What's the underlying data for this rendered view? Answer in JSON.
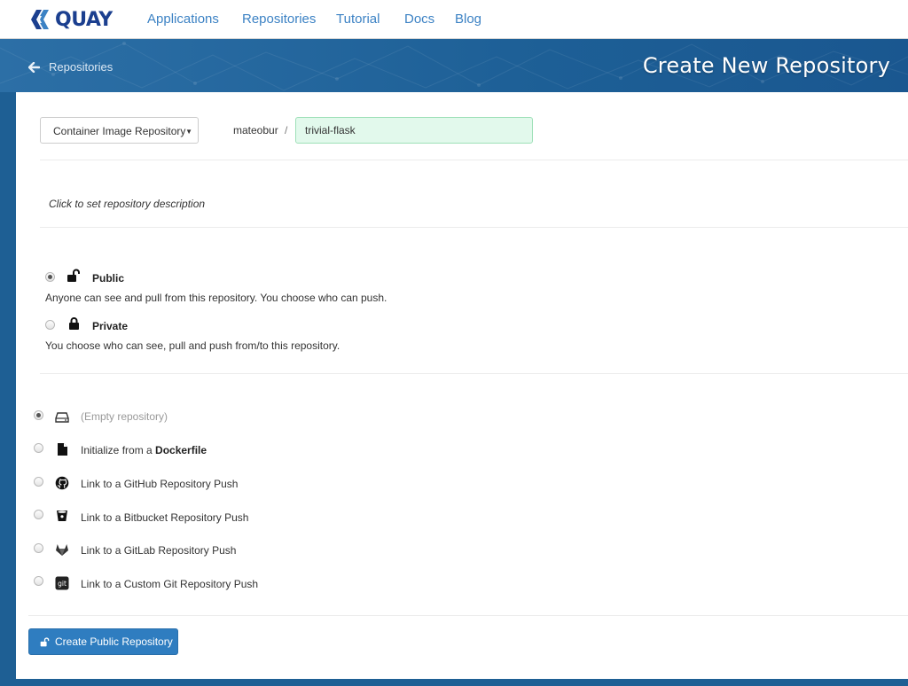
{
  "brand": {
    "name": "QUAY",
    "color": "#1b3f8f"
  },
  "nav": {
    "links": [
      "Applications",
      "Repositories",
      "Tutorial",
      "Docs",
      "Blog"
    ],
    "link_color": "#3c82c4"
  },
  "banner": {
    "back_label": "Repositories",
    "title": "Create New Repository"
  },
  "form": {
    "repo_kind": "Container Image Repository",
    "namespace": "mateobur",
    "separator": "/",
    "repo_name": "trivial-flask",
    "description_placeholder": "Click to set repository description"
  },
  "visibility": {
    "selected": "public",
    "options": [
      {
        "id": "public",
        "label": "Public",
        "icon": "unlock-icon",
        "description": "Anyone can see and pull from this repository. You choose who can push."
      },
      {
        "id": "private",
        "label": "Private",
        "icon": "lock-icon",
        "description": "You choose who can see, pull and push from/to this repository."
      }
    ]
  },
  "initialization": {
    "selected": "empty",
    "options": [
      {
        "id": "empty",
        "icon": "drive-icon",
        "label": "(Empty repository)"
      },
      {
        "id": "dockerfile",
        "icon": "file-icon",
        "label_prefix": "Initialize from a ",
        "label_bold": "Dockerfile"
      },
      {
        "id": "github",
        "icon": "github-icon",
        "label": "Link to a GitHub Repository Push"
      },
      {
        "id": "bitbucket",
        "icon": "bitbucket-icon",
        "label": "Link to a Bitbucket Repository Push"
      },
      {
        "id": "gitlab",
        "icon": "gitlab-icon",
        "label": "Link to a GitLab Repository Push"
      },
      {
        "id": "custom-git",
        "icon": "git-icon",
        "label": "Link to a Custom Git Repository Push"
      }
    ]
  },
  "submit": {
    "label": "Create Public Repository",
    "color": "#2f7dc0"
  }
}
